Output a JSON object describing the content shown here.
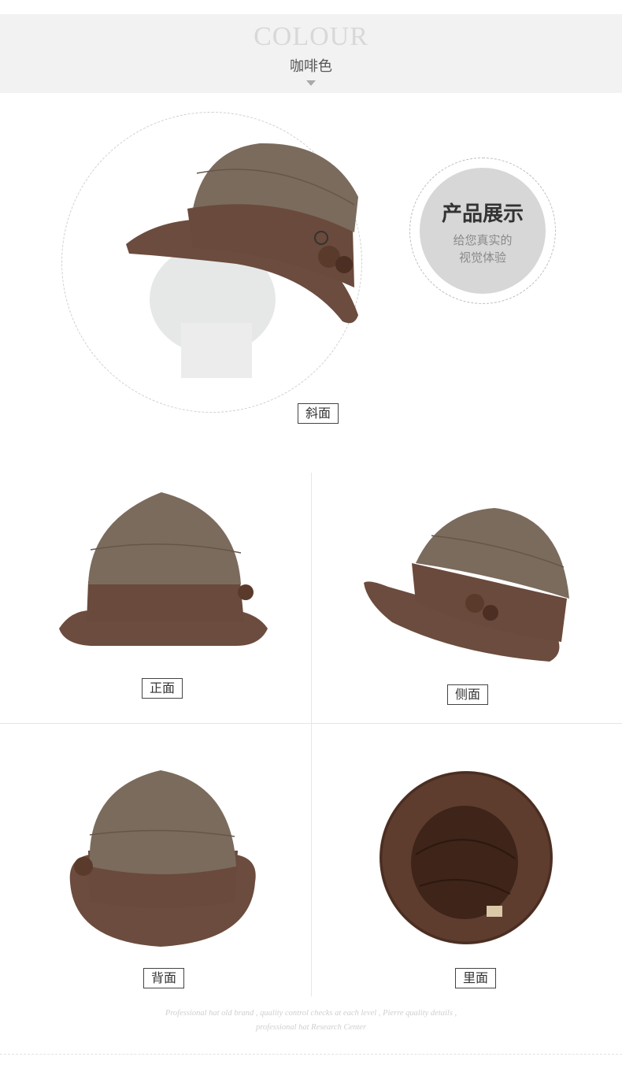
{
  "header": {
    "title_en": "COLOUR",
    "title_cn": "咖啡色"
  },
  "badge": {
    "title": "产品展示",
    "subtitle_line1": "给您真实的",
    "subtitle_line2": "视觉体验"
  },
  "views": {
    "angle": "斜面",
    "front": "正面",
    "side": "侧面",
    "back": "背面",
    "inside": "里面"
  },
  "footer": {
    "line1": "Professional hat old brand , quality control checks at each level , Pierre quality details ,",
    "line2": "professional hat Research Center"
  },
  "colors": {
    "crown": "#7a6a5c",
    "brim": "#6a4a3c",
    "inner": "#4a2e22"
  }
}
